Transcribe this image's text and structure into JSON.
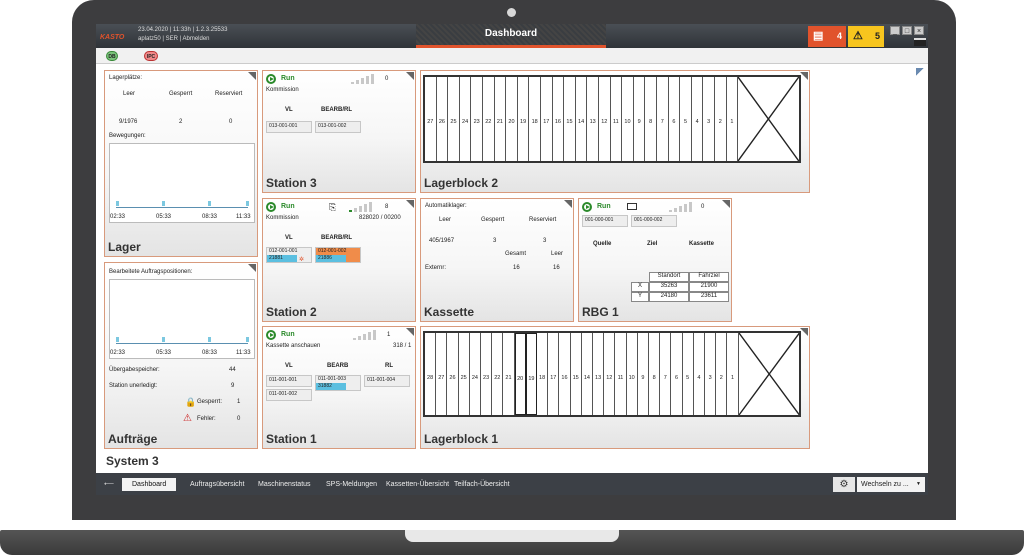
{
  "header": {
    "logo": "KASTO",
    "datetime": "23.04.2020 | 11:33h | 1.2.3.25533",
    "user": "aplatz50 | SER | Abmelden",
    "title": "Dashboard",
    "alarm_red_count": "4",
    "alarm_yellow_count": "5",
    "pill1": "DB",
    "pill2": "IPC"
  },
  "lager": {
    "title": "Lager",
    "heading": "Lagerplätze:",
    "cols": [
      "Leer",
      "Gesperrt",
      "Reserviert"
    ],
    "values": [
      "9/1976",
      "2",
      "0"
    ],
    "bewegungen": "Bewegungen:",
    "ticks": [
      "02:33",
      "05:33",
      "08:33",
      "11:33"
    ]
  },
  "auftraege": {
    "title": "Aufträge",
    "heading": "Bearbeitete Auftragspositionen:",
    "ticks": [
      "02:33",
      "05:33",
      "08:33",
      "11:33"
    ],
    "rows": [
      {
        "label": "Übergabespeicher:",
        "value": "44"
      },
      {
        "label": "Station unerledigt:",
        "value": "9"
      },
      {
        "label": "Gesperrt:",
        "value": "1"
      },
      {
        "label": "Fehler:",
        "value": "0"
      }
    ]
  },
  "system_title": "System 3",
  "station3": {
    "title": "Station 3",
    "status": "Run",
    "mode": "Kommission",
    "count": "0",
    "cols": [
      "VL",
      "BEARB/RL"
    ],
    "boxes": [
      "013-001-001",
      "013-001-002"
    ]
  },
  "station2": {
    "title": "Station 2",
    "status": "Run",
    "mode": "Kommission",
    "count": "8",
    "weight": "828020 / 00200",
    "cols": [
      "VL",
      "BEARB/RL"
    ],
    "box1": [
      "012-001-001",
      "21881"
    ],
    "box2": [
      "012-001-002",
      "21886"
    ]
  },
  "station1": {
    "title": "Station 1",
    "status": "Run",
    "mode": "Kassette anschauen",
    "count": "1",
    "ratio": "318 / 1",
    "cols": [
      "VL",
      "BEARB",
      "RL"
    ],
    "vl": [
      "011-001-001",
      "011-001-002"
    ],
    "bearb": [
      "011-001-003",
      "31882"
    ],
    "rl": "011-001-004"
  },
  "kassette": {
    "title": "Kassette",
    "heading": "Automatiklager:",
    "cols": [
      "Leer",
      "Gesperrt",
      "Reserviert"
    ],
    "values": [
      "405/1967",
      "3",
      "3"
    ],
    "cols2": [
      "Gesamt",
      "Leer"
    ],
    "extern_label": "Externr:",
    "extern_values": [
      "16",
      "16"
    ]
  },
  "rbg": {
    "title": "RBG 1",
    "status": "Run",
    "count": "0",
    "boxes": [
      "001-000-001",
      "001-000-002"
    ],
    "cols": [
      "Quelle",
      "Ziel",
      "Kassette"
    ],
    "table_head": [
      "Standort",
      "Fahrziel"
    ],
    "table_rows": [
      {
        "axis": "X",
        "standort": "35263",
        "fahrziel": "21900"
      },
      {
        "axis": "Y",
        "standort": "24180",
        "fahrziel": "23611"
      }
    ]
  },
  "lagerblock2": {
    "title": "Lagerblock 2",
    "cells": [
      "27",
      "26",
      "25",
      "24",
      "23",
      "22",
      "21",
      "20",
      "19",
      "18",
      "17",
      "16",
      "15",
      "14",
      "13",
      "12",
      "11",
      "10",
      "9",
      "8",
      "7",
      "6",
      "5",
      "4",
      "3",
      "2",
      "1"
    ]
  },
  "lagerblock1": {
    "title": "Lagerblock 1",
    "cells": [
      "28",
      "27",
      "26",
      "25",
      "24",
      "23",
      "22",
      "21",
      "20",
      "19",
      "18",
      "17",
      "16",
      "15",
      "14",
      "13",
      "12",
      "11",
      "10",
      "9",
      "8",
      "7",
      "6",
      "5",
      "4",
      "3",
      "2",
      "1"
    ]
  },
  "tabs": {
    "back": "⟵",
    "items": [
      "Dashboard",
      "Auftragsübersicht",
      "Maschinenstatus",
      "SPS-Meldungen",
      "Kassetten-Übersicht",
      "Teilfach-Übersicht"
    ],
    "switch": "Wechseln zu ..."
  }
}
